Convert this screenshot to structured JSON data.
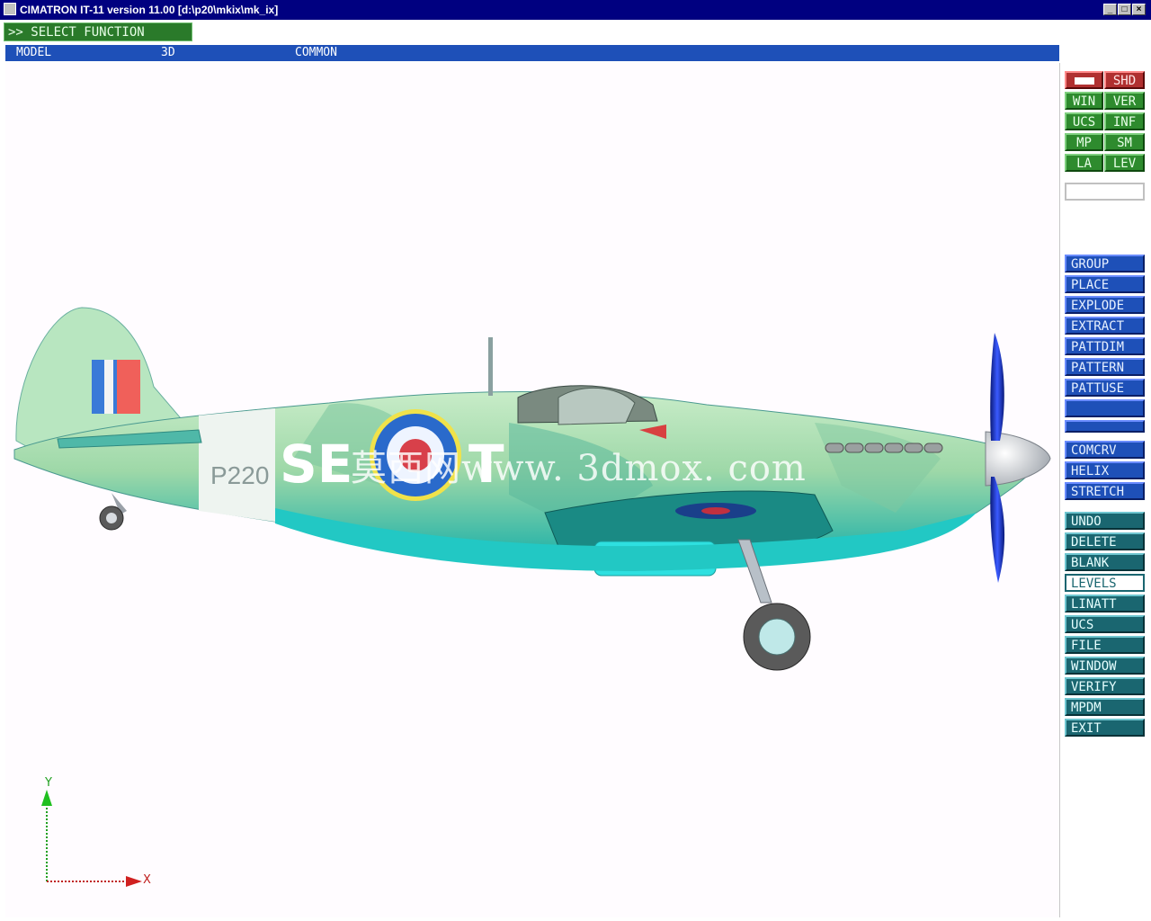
{
  "window": {
    "title": "CIMATRON IT-11 version 11.00 [d:\\p20\\mkix\\mk_ix]",
    "minimize": "_",
    "maximize": "□",
    "close": "×"
  },
  "prompt": ">> SELECT FUNCTION",
  "menubar": [
    "MODEL",
    "3D",
    "COMMON"
  ],
  "toolbar_grid": [
    [
      "",
      "SHD"
    ],
    [
      "WIN",
      "VER"
    ],
    [
      "UCS",
      "INF"
    ],
    [
      "MP",
      "SM"
    ],
    [
      "LA",
      "LEV"
    ]
  ],
  "function_buttons": [
    "GROUP",
    "PLACE",
    "EXPLODE",
    "EXTRACT",
    "PATTDIM",
    "PATTERN",
    "PATTUSE",
    "",
    "COMCRV",
    "HELIX",
    "STRETCH"
  ],
  "common_buttons": [
    "UNDO",
    "DELETE",
    "BLANK",
    "LEVELS",
    "LINATT",
    "UCS",
    "FILE",
    "WINDOW",
    "VERIFY",
    "MPDM",
    "EXIT"
  ],
  "selected_common": "LEVELS",
  "model": {
    "serial": "P220",
    "squadron_code": "SE",
    "squadron_code_tail": "T"
  },
  "watermark": "莫西网www. 3dmox. com",
  "axes": {
    "y_label": "Y",
    "x_label": "X"
  },
  "colors": {
    "menu_blue": "#1e50b8",
    "prompt_green": "#2a7a2a",
    "button_teal": "#1a6670",
    "camo_green": "#9ed8a8",
    "camo_teal": "#1fb5b2",
    "roundel_blue": "#2a6acb",
    "roundel_red": "#d8404a"
  }
}
